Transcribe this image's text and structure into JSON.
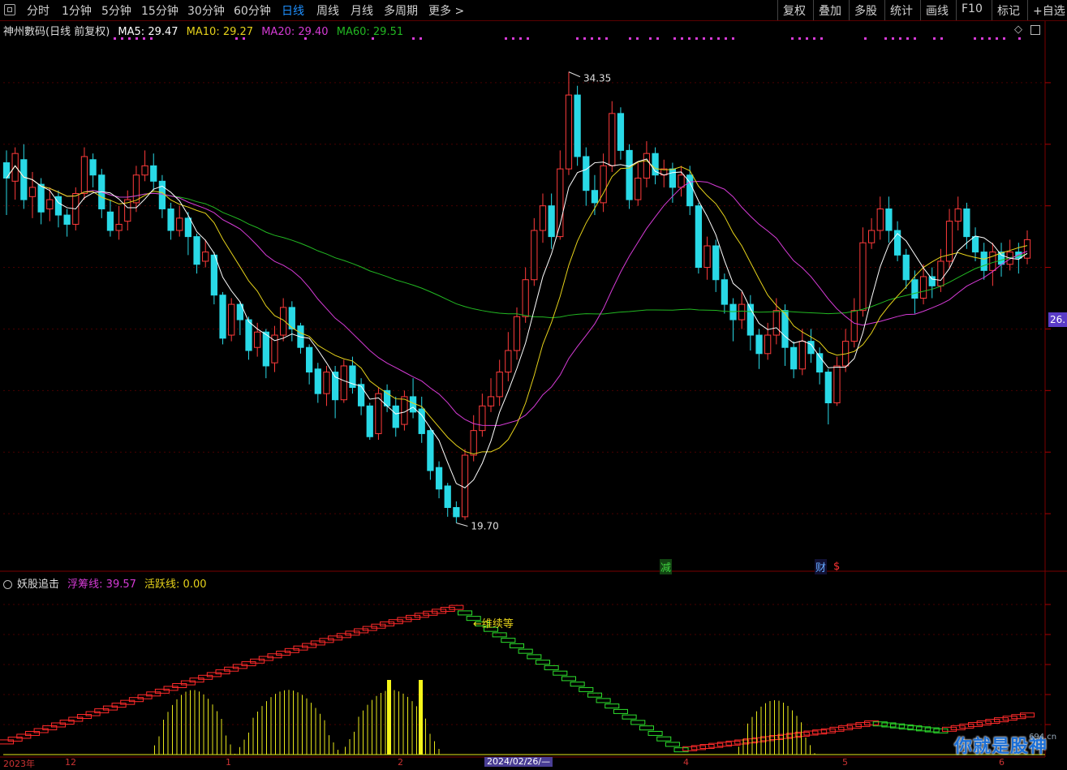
{
  "toolbar": {
    "left_items": [
      "分时",
      "1分钟",
      "5分钟",
      "15分钟",
      "30分钟",
      "60分钟",
      "日线",
      "周线",
      "月线",
      "多周期",
      "更多 >"
    ],
    "active": "日线",
    "right_items": [
      "复权",
      "叠加",
      "多股",
      "统计",
      "画线",
      "F10",
      "标记",
      "+自选"
    ]
  },
  "stock": {
    "title": "神州數码(日线 前复权)",
    "ma5": "MA5: 29.47",
    "ma10": "MA10: 29.27",
    "ma20": "MA20: 29.40",
    "ma60": "MA60: 29.51"
  },
  "colors": {
    "up": "#ff3b3b",
    "down": "#29d9e6",
    "ma5": "#ffffff",
    "ma10": "#e6d21a",
    "ma20": "#d63bd6",
    "ma60": "#22b822",
    "purple": "#d63bd6"
  },
  "annotations": {
    "high": "34.35",
    "low": "19.70",
    "current_price": "26.",
    "follow": "←维续等"
  },
  "markers": {
    "reduce": "减",
    "finance": "财",
    "dollar": "$"
  },
  "indicator": {
    "name": "妖股追击",
    "line1": "浮筹线: 39.57",
    "line2": "活跃线: 0.00"
  },
  "axis_dates": {
    "selected": "2024/02/26/—",
    "labels": [
      "2023年",
      "12",
      "1",
      "2",
      "4",
      "5",
      "6"
    ]
  },
  "watermark": {
    "main": "你就是股神",
    "site": "694.cn"
  },
  "chart_data": {
    "type": "candlestick",
    "title": "神州數码(日线 前复权)",
    "high": 34.35,
    "low": 19.7,
    "ylim": [
      18.5,
      35.5
    ],
    "candles": [
      [
        31.4,
        30.9,
        31.8,
        29.7
      ],
      [
        30.8,
        31.7,
        31.9,
        30.2
      ],
      [
        31.5,
        30.2,
        32.0,
        29.9
      ],
      [
        30.3,
        30.6,
        31.1,
        29.6
      ],
      [
        30.7,
        29.8,
        30.9,
        29.4
      ],
      [
        29.9,
        30.2,
        30.6,
        29.5
      ],
      [
        30.3,
        29.7,
        30.5,
        29.3
      ],
      [
        29.7,
        29.4,
        29.9,
        29.0
      ],
      [
        29.4,
        30.4,
        30.6,
        29.2
      ],
      [
        30.4,
        31.6,
        31.9,
        30.2
      ],
      [
        31.5,
        31.0,
        31.7,
        30.6
      ],
      [
        31.0,
        29.9,
        31.2,
        29.6
      ],
      [
        29.8,
        29.2,
        30.2,
        29.0
      ],
      [
        29.2,
        29.4,
        30.0,
        28.9
      ],
      [
        29.5,
        30.2,
        30.5,
        29.2
      ],
      [
        30.1,
        31.0,
        31.3,
        29.8
      ],
      [
        31.0,
        31.3,
        31.8,
        30.8
      ],
      [
        31.3,
        30.8,
        31.7,
        30.5
      ],
      [
        30.8,
        29.9,
        31.0,
        29.6
      ],
      [
        29.9,
        29.2,
        30.1,
        28.9
      ],
      [
        29.2,
        29.6,
        30.0,
        29.0
      ],
      [
        29.6,
        29.0,
        29.8,
        28.4
      ],
      [
        29.0,
        28.1,
        29.1,
        27.8
      ],
      [
        28.2,
        28.5,
        28.9,
        28.0
      ],
      [
        28.4,
        27.1,
        28.5,
        26.8
      ],
      [
        27.1,
        25.7,
        27.2,
        25.5
      ],
      [
        25.8,
        26.8,
        27.0,
        25.6
      ],
      [
        26.8,
        26.3,
        26.9,
        25.8
      ],
      [
        26.3,
        25.3,
        26.4,
        25.0
      ],
      [
        25.4,
        25.9,
        26.2,
        25.1
      ],
      [
        25.9,
        24.8,
        26.0,
        24.4
      ],
      [
        24.9,
        25.8,
        26.1,
        24.6
      ],
      [
        25.8,
        26.7,
        27.0,
        25.6
      ],
      [
        26.7,
        26.0,
        26.9,
        25.6
      ],
      [
        26.1,
        25.4,
        26.2,
        25.2
      ],
      [
        25.4,
        24.6,
        25.5,
        24.2
      ],
      [
        24.7,
        23.9,
        24.9,
        23.6
      ],
      [
        23.9,
        24.6,
        24.8,
        23.5
      ],
      [
        24.6,
        23.7,
        24.8,
        23.1
      ],
      [
        23.7,
        24.8,
        25.0,
        23.6
      ],
      [
        24.8,
        24.1,
        25.1,
        23.9
      ],
      [
        24.2,
        23.5,
        24.4,
        23.2
      ],
      [
        23.5,
        22.5,
        23.6,
        22.4
      ],
      [
        22.6,
        23.9,
        24.1,
        22.4
      ],
      [
        24.0,
        23.5,
        24.2,
        23.3
      ],
      [
        23.5,
        22.8,
        23.8,
        22.5
      ],
      [
        22.9,
        23.8,
        24.0,
        22.7
      ],
      [
        23.8,
        23.3,
        24.4,
        23.1
      ],
      [
        23.4,
        22.6,
        23.8,
        22.3
      ],
      [
        22.7,
        21.4,
        22.8,
        21.1
      ],
      [
        21.5,
        20.8,
        21.7,
        20.5
      ],
      [
        20.9,
        20.2,
        21.0,
        19.9
      ],
      [
        20.2,
        19.9,
        20.4,
        19.7
      ],
      [
        19.9,
        21.9,
        22.1,
        19.8
      ],
      [
        21.9,
        22.7,
        23.2,
        21.7
      ],
      [
        22.7,
        23.5,
        23.9,
        22.5
      ],
      [
        23.5,
        23.8,
        24.4,
        23.3
      ],
      [
        23.8,
        24.6,
        25.0,
        23.5
      ],
      [
        24.6,
        25.3,
        25.9,
        24.3
      ],
      [
        25.3,
        26.4,
        26.7,
        25.0
      ],
      [
        26.4,
        27.6,
        28.0,
        26.2
      ],
      [
        27.6,
        29.2,
        29.6,
        27.4
      ],
      [
        29.2,
        30.0,
        30.4,
        28.8
      ],
      [
        30.0,
        29.0,
        30.4,
        28.6
      ],
      [
        29.0,
        31.2,
        31.8,
        28.9
      ],
      [
        31.2,
        33.6,
        34.35,
        31.0
      ],
      [
        33.6,
        31.6,
        33.9,
        31.3
      ],
      [
        31.6,
        30.5,
        31.9,
        30.0
      ],
      [
        30.5,
        30.1,
        31.0,
        29.7
      ],
      [
        30.1,
        31.3,
        31.7,
        29.8
      ],
      [
        31.3,
        33.0,
        33.4,
        31.1
      ],
      [
        33.0,
        31.8,
        33.2,
        31.5
      ],
      [
        31.8,
        30.2,
        32.0,
        29.9
      ],
      [
        30.2,
        30.9,
        31.4,
        30.0
      ],
      [
        30.9,
        31.7,
        32.1,
        30.6
      ],
      [
        31.7,
        31.0,
        31.9,
        30.7
      ],
      [
        31.0,
        31.2,
        31.5,
        30.6
      ],
      [
        31.2,
        30.6,
        31.4,
        30.1
      ],
      [
        30.6,
        31.0,
        31.3,
        30.3
      ],
      [
        31.0,
        30.0,
        31.3,
        29.7
      ],
      [
        30.0,
        28.0,
        30.1,
        27.8
      ],
      [
        28.0,
        28.7,
        29.0,
        27.6
      ],
      [
        28.7,
        27.6,
        28.9,
        27.2
      ],
      [
        27.6,
        26.8,
        27.8,
        26.5
      ],
      [
        26.8,
        26.3,
        27.0,
        25.6
      ],
      [
        26.3,
        26.8,
        27.2,
        26.0
      ],
      [
        26.8,
        25.8,
        27.1,
        25.3
      ],
      [
        25.8,
        25.2,
        26.0,
        24.7
      ],
      [
        25.2,
        25.8,
        26.2,
        25.0
      ],
      [
        25.8,
        26.6,
        27.0,
        25.5
      ],
      [
        26.6,
        25.4,
        26.8,
        24.8
      ],
      [
        25.4,
        24.7,
        25.6,
        24.4
      ],
      [
        24.7,
        25.6,
        26.0,
        24.5
      ],
      [
        25.6,
        25.2,
        26.0,
        24.9
      ],
      [
        25.2,
        24.6,
        25.4,
        24.2
      ],
      [
        24.6,
        23.6,
        24.7,
        22.9
      ],
      [
        23.6,
        24.8,
        25.1,
        23.5
      ],
      [
        24.8,
        25.6,
        26.0,
        24.6
      ],
      [
        25.6,
        26.6,
        27.0,
        25.4
      ],
      [
        26.6,
        28.8,
        29.3,
        26.4
      ],
      [
        28.8,
        29.2,
        29.6,
        28.6
      ],
      [
        29.2,
        29.9,
        30.3,
        28.9
      ],
      [
        29.9,
        29.2,
        30.3,
        28.8
      ],
      [
        29.2,
        28.4,
        29.5,
        28.2
      ],
      [
        28.4,
        27.6,
        28.6,
        27.3
      ],
      [
        27.6,
        27.0,
        27.9,
        26.5
      ],
      [
        27.0,
        27.7,
        28.1,
        26.8
      ],
      [
        27.7,
        27.4,
        28.0,
        27.0
      ],
      [
        27.4,
        28.2,
        28.6,
        27.2
      ],
      [
        28.2,
        29.5,
        29.9,
        28.0
      ],
      [
        29.5,
        29.9,
        30.3,
        29.2
      ],
      [
        29.9,
        29.0,
        30.1,
        28.6
      ],
      [
        29.0,
        28.5,
        29.3,
        28.2
      ],
      [
        28.5,
        27.9,
        28.8,
        27.6
      ],
      [
        27.9,
        28.5,
        28.8,
        27.4
      ],
      [
        28.5,
        28.1,
        28.8,
        27.7
      ],
      [
        28.1,
        28.5,
        28.9,
        27.9
      ],
      [
        28.5,
        28.3,
        28.8,
        27.8
      ],
      [
        28.3,
        28.9,
        29.2,
        28.1
      ]
    ]
  }
}
